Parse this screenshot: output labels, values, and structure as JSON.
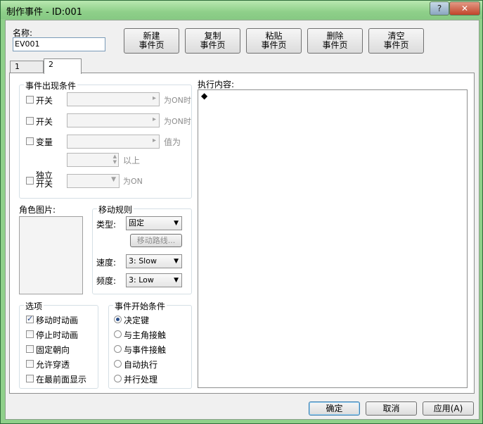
{
  "window": {
    "title": "制作事件 - ID:001",
    "help": "?",
    "close": "✕"
  },
  "name": {
    "label": "名称:",
    "value": "EV001"
  },
  "page_buttons": [
    {
      "l1": "新建",
      "l2": "事件页"
    },
    {
      "l1": "复制",
      "l2": "事件页"
    },
    {
      "l1": "粘贴",
      "l2": "事件页"
    },
    {
      "l1": "删除",
      "l2": "事件页"
    },
    {
      "l1": "清空",
      "l2": "事件页"
    }
  ],
  "tabs": [
    "1",
    "2"
  ],
  "conditions": {
    "title": "事件出现条件",
    "switch1": {
      "label": "开关",
      "suffix": "为ON时"
    },
    "switch2": {
      "label": "开关",
      "suffix": "为ON时"
    },
    "variable": {
      "label": "变量",
      "suffix": "值为",
      "above": "以上"
    },
    "self_switch": {
      "l1": "独立",
      "l2": "开关",
      "suffix": "为ON"
    }
  },
  "graphic": {
    "label": "角色图片:"
  },
  "movement": {
    "title": "移动规则",
    "type_label": "类型:",
    "type_value": "固定",
    "route_button": "移动路线...",
    "speed_label": "速度:",
    "speed_value": "3: Slow",
    "freq_label": "频度:",
    "freq_value": "3: Low"
  },
  "options": {
    "title": "选项",
    "items": [
      {
        "label": "移动时动画",
        "checked": true
      },
      {
        "label": "停止时动画",
        "checked": false
      },
      {
        "label": "固定朝向",
        "checked": false
      },
      {
        "label": "允许穿透",
        "checked": false
      },
      {
        "label": "在最前面显示",
        "checked": false
      }
    ]
  },
  "trigger": {
    "title": "事件开始条件",
    "items": [
      {
        "label": "决定键",
        "checked": true
      },
      {
        "label": "与主角接触",
        "checked": false
      },
      {
        "label": "与事件接触",
        "checked": false
      },
      {
        "label": "自动执行",
        "checked": false
      },
      {
        "label": "并行处理",
        "checked": false
      }
    ]
  },
  "execution": {
    "label": "执行内容:",
    "marker": "◆"
  },
  "dialog_buttons": {
    "ok": "确定",
    "cancel": "取消",
    "apply": "应用(A)"
  }
}
